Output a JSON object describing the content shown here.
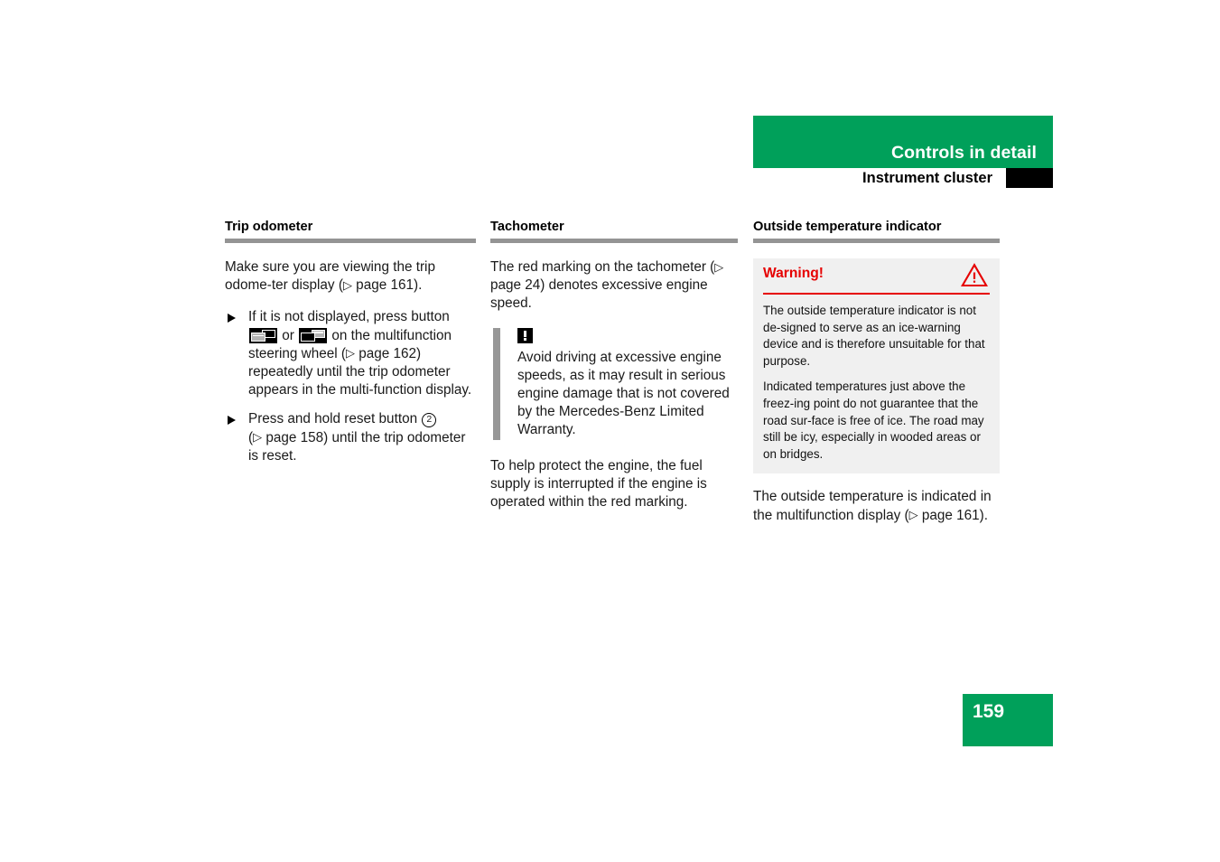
{
  "header": {
    "chapter_title": "Controls in detail",
    "section_title": "Instrument cluster",
    "green_hex": "#00a05a",
    "tab_hex": "#000000"
  },
  "columns": {
    "trip_odometer": {
      "heading": "Trip odometer",
      "intro_part1": "Make sure you are viewing the trip odome-ter display (",
      "intro_ref_arrow": "▷",
      "intro_ref_page": " page 161).",
      "steps": [
        {
          "text_before_icon1": "If it is not displayed, press button ",
          "icon1_name": "mfs-button-forward-icon",
          "text_between": "or ",
          "icon2_name": "mfs-button-back-icon",
          "text_after_part1": "on the multifunction steering wheel (",
          "ref_arrow": "▷",
          "text_after_part2": " page 162) repeatedly until the trip odometer appears in the multi-function display."
        },
        {
          "text_before_num": "Press and hold reset button ",
          "circled_number": "2",
          "text_after_part1": "(",
          "ref_arrow": "▷",
          "text_after_part2": " page 158) until the trip odometer is reset."
        }
      ]
    },
    "tachometer": {
      "heading": "Tachometer",
      "paragraph1_part1": "The red marking on the tachometer (",
      "paragraph1_ref_arrow": "▷",
      "paragraph1_part2": " page 24) denotes excessive engine speed.",
      "caution": {
        "icon_name": "exclamation-icon",
        "text": "Avoid driving at excessive engine speeds, as it may result in serious engine damage that is not covered by the Mercedes-Benz Limited Warranty."
      },
      "paragraph2": "To help protect the engine, the fuel supply is interrupted if the engine is operated within the red marking."
    },
    "outside_temperature": {
      "heading": "Outside temperature indicator",
      "warning": {
        "title": "Warning!",
        "title_hex": "#e60000",
        "icon_name": "warning-triangle-icon",
        "background_hex": "#f0f0f0",
        "paragraphs": [
          "The outside temperature indicator is not de-signed to serve as an ice-warning device and is therefore unsuitable for that purpose.",
          "Indicated temperatures just above the freez-ing point do not guarantee that the road sur-face is free of ice. The road may still be icy, especially in wooded areas or on bridges."
        ]
      },
      "closing_part1": "The outside temperature is indicated in the multifunction display (",
      "closing_ref_arrow": "▷",
      "closing_part2": " page 161)."
    }
  },
  "footer": {
    "page_number": "159",
    "background_hex": "#00a05a"
  }
}
